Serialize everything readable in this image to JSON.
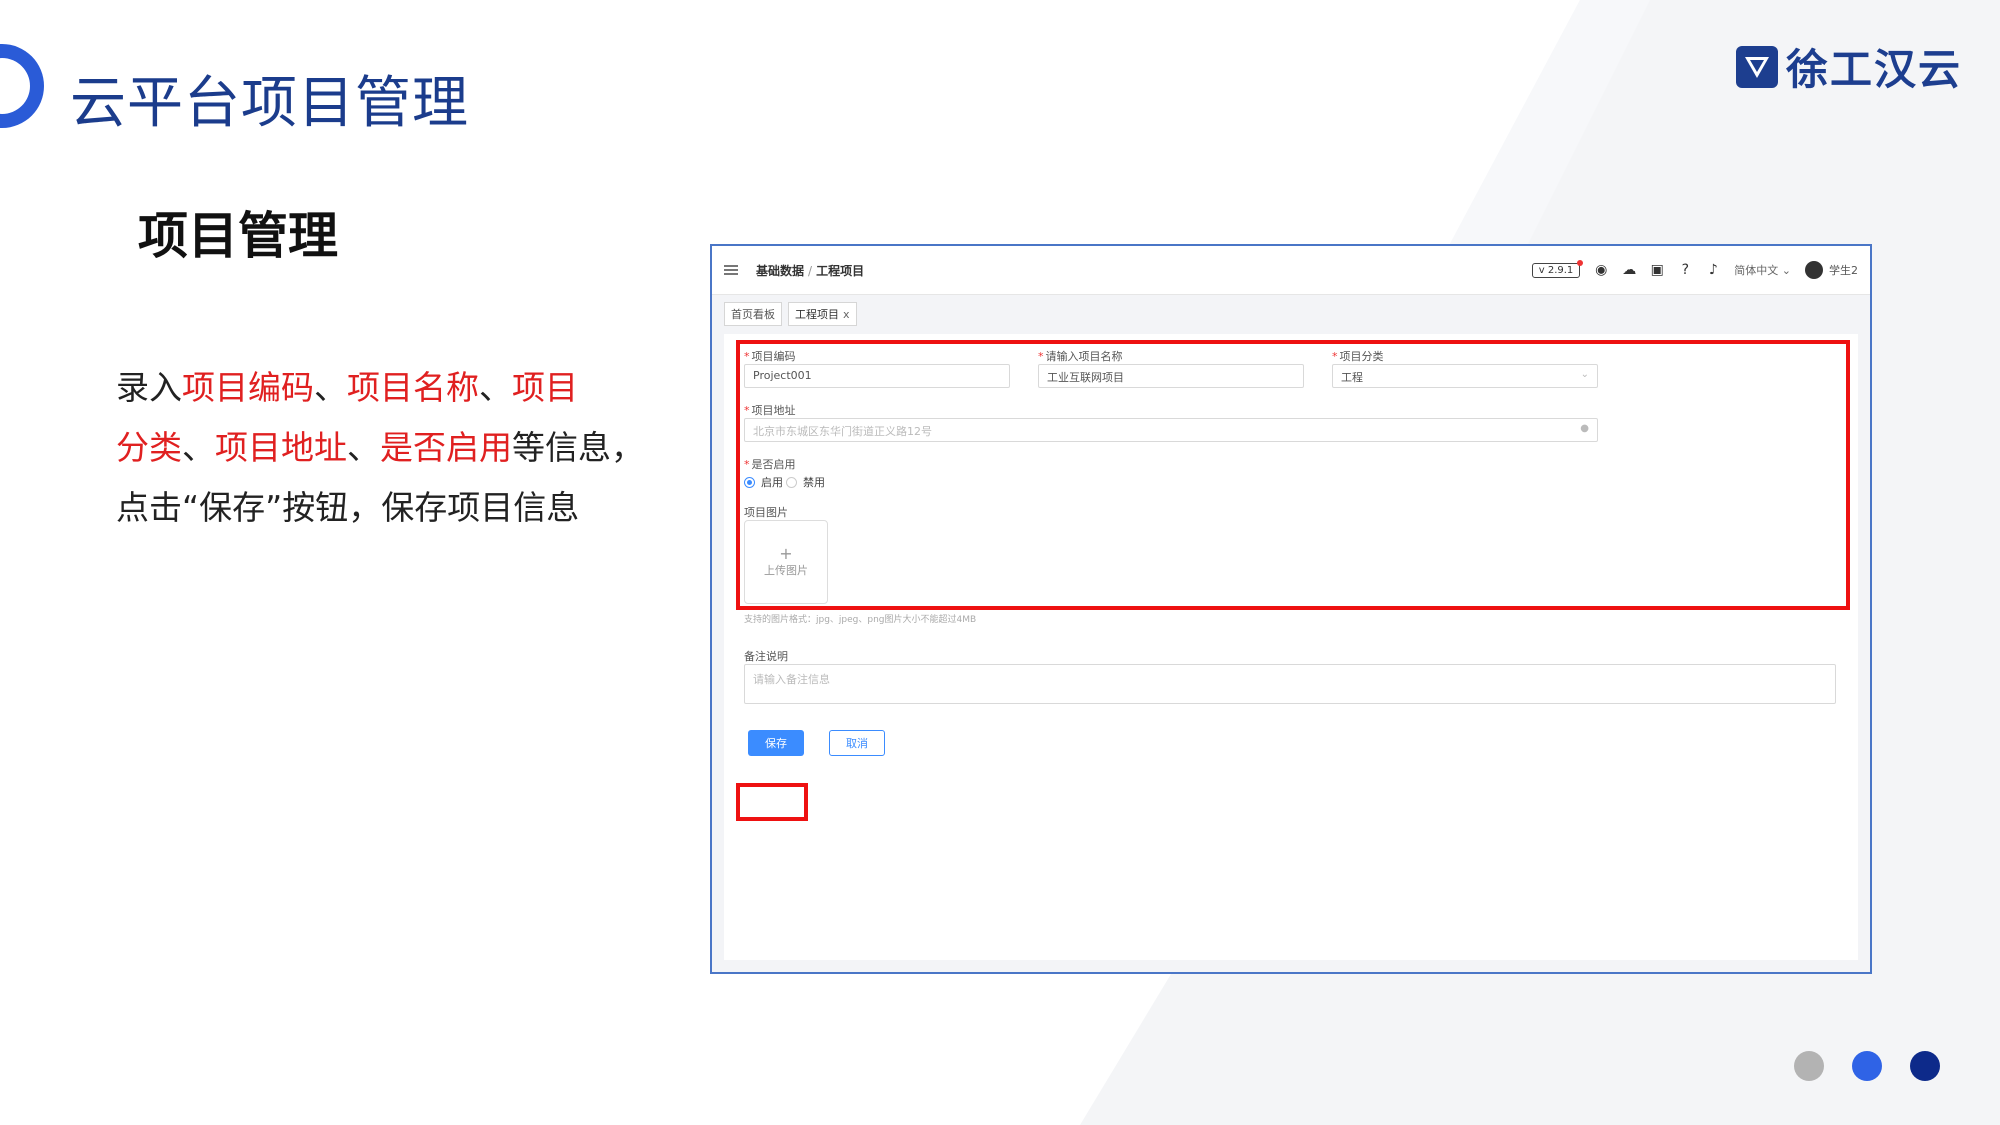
{
  "slide": {
    "title": "云平台项目管理",
    "logo_text": "徐工汉云",
    "section_heading": "项目管理",
    "description": {
      "line1": [
        "录入",
        "项目编码",
        "、",
        "项目名称",
        "、",
        "项目"
      ],
      "line2": [
        "分类",
        "、",
        "项目地址",
        "、",
        "是否启用",
        "等信息，"
      ],
      "line3": "点击“保存”按钮，保存项目信息"
    },
    "pager_colors": [
      "#b3b3b3",
      "#2f63e6",
      "#0d2a8a"
    ]
  },
  "app": {
    "breadcrumb_parent": "基础数据",
    "breadcrumb_sep": "/",
    "breadcrumb_current": "工程项目",
    "version": "v 2.9.1",
    "language": "简体中文",
    "user": "学生2",
    "tabs": [
      {
        "label": "首页看板"
      },
      {
        "label": "工程项目",
        "close": "x"
      }
    ],
    "form": {
      "code_label": "项目编码",
      "code_value": "Project001",
      "name_label": "请输入项目名称",
      "name_value": "工业互联网项目",
      "category_label": "项目分类",
      "category_value": "工程",
      "address_label": "项目地址",
      "address_value": "北京市东城区东华门街道正义路12号",
      "enabled_label": "是否启用",
      "enabled_on": "启用",
      "enabled_off": "禁用",
      "image_label": "项目图片",
      "upload_plus": "+",
      "upload_label": "上传图片",
      "upload_hint": "支持的图片格式：jpg、jpeg、png图片大小不能超过4MB",
      "remark_label": "备注说明",
      "remark_placeholder": "请输入备注信息",
      "save": "保存",
      "cancel": "取消"
    }
  }
}
